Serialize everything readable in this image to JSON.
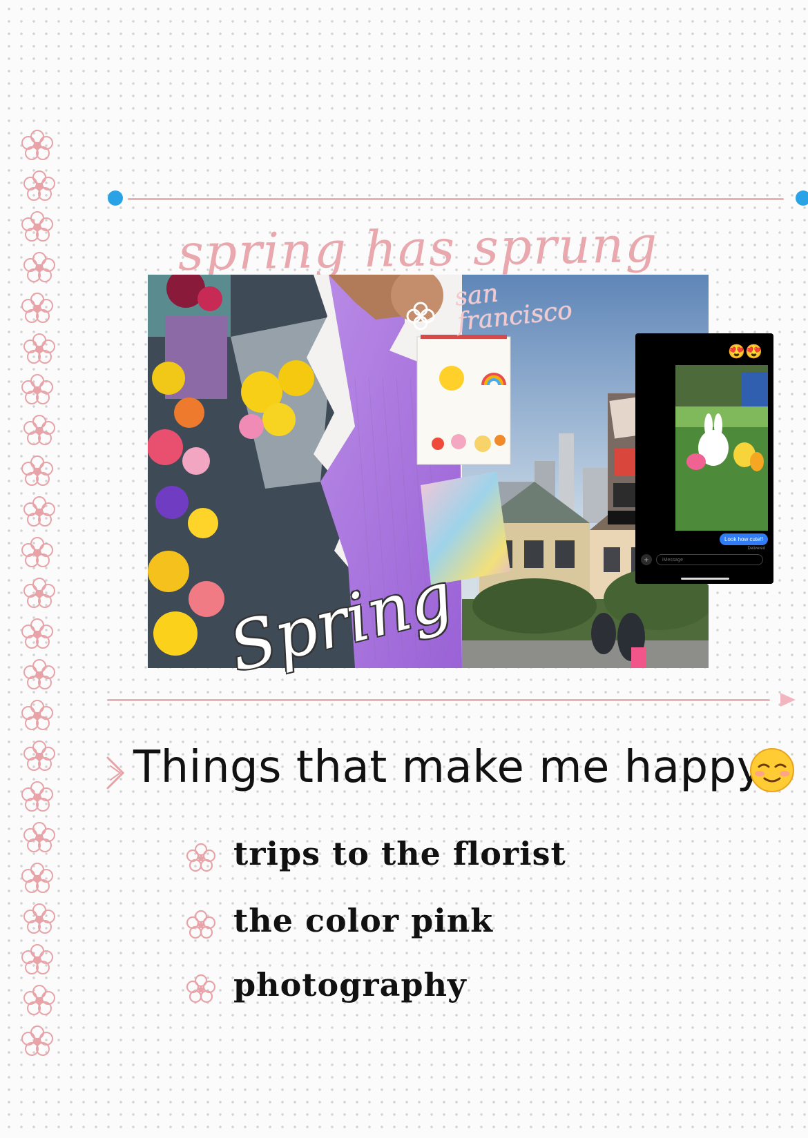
{
  "page": {
    "header_title": "spring has sprung",
    "collage": {
      "overlay_city": "san\nfrancisco",
      "overlay_word": "Spring",
      "phone": {
        "reaction": "😍😍",
        "message": "Look how cute!!",
        "status": "Delivered",
        "input_placeholder": "iMessage",
        "plus_glyph": "+"
      }
    },
    "section_heading": "Things that make me happy",
    "list_items": [
      {
        "label": "trips to the florist"
      },
      {
        "label": "the color pink"
      },
      {
        "label": "photography"
      }
    ]
  },
  "colors": {
    "accent_pink": "#e8a8ad",
    "handle_blue": "#2aa3e6",
    "grid_dot": "#d2d2d2"
  },
  "icons": {
    "margin_flower": "flower-doodle-icon",
    "bullet": "flower-doodle-icon",
    "heading_emoji": "smiling-face-icon"
  }
}
